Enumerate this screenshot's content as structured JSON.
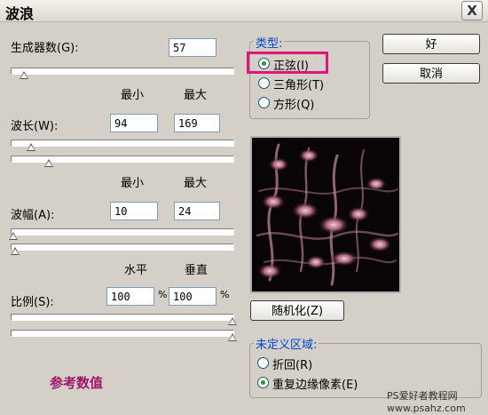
{
  "window": {
    "title": "波浪",
    "close_glyph": "X"
  },
  "generators": {
    "label": "生成器数(G):",
    "value": "57"
  },
  "col_headers": {
    "min": "最小",
    "max": "最大"
  },
  "wavelength": {
    "label": "波长(W):",
    "min": "94",
    "max": "169",
    "min_fraction": 0.09,
    "max_fraction": 0.17
  },
  "amplitude": {
    "label": "波幅(A):",
    "min": "10",
    "max": "24",
    "min_fraction": 0.01,
    "max_fraction": 0.02
  },
  "scale_headers": {
    "h": "水平",
    "v": "垂直"
  },
  "scale": {
    "label": "比例(S):",
    "h": "100",
    "v": "100",
    "unit": "%",
    "h_fraction": 1.0,
    "v_fraction": 1.0
  },
  "generators_fraction": 0.06,
  "type_group": {
    "label": "类型:",
    "options": [
      "正弦(I)",
      "三角形(T)",
      "方形(Q)"
    ],
    "selected": 0
  },
  "buttons": {
    "ok": "好",
    "cancel": "取消",
    "randomize": "随机化(Z)"
  },
  "undefined_group": {
    "label": "未定义区域:",
    "options": [
      "折回(R)",
      "重复边缘像素(E)"
    ],
    "selected": 1
  },
  "annotation": "参考数值",
  "watermark": {
    "line1": "PS爱好者教程网",
    "line2": "www.psahz.com"
  },
  "colors": {
    "highlight": "#e0157a",
    "group_label": "#0046d5",
    "annotation": "#a0146e"
  }
}
